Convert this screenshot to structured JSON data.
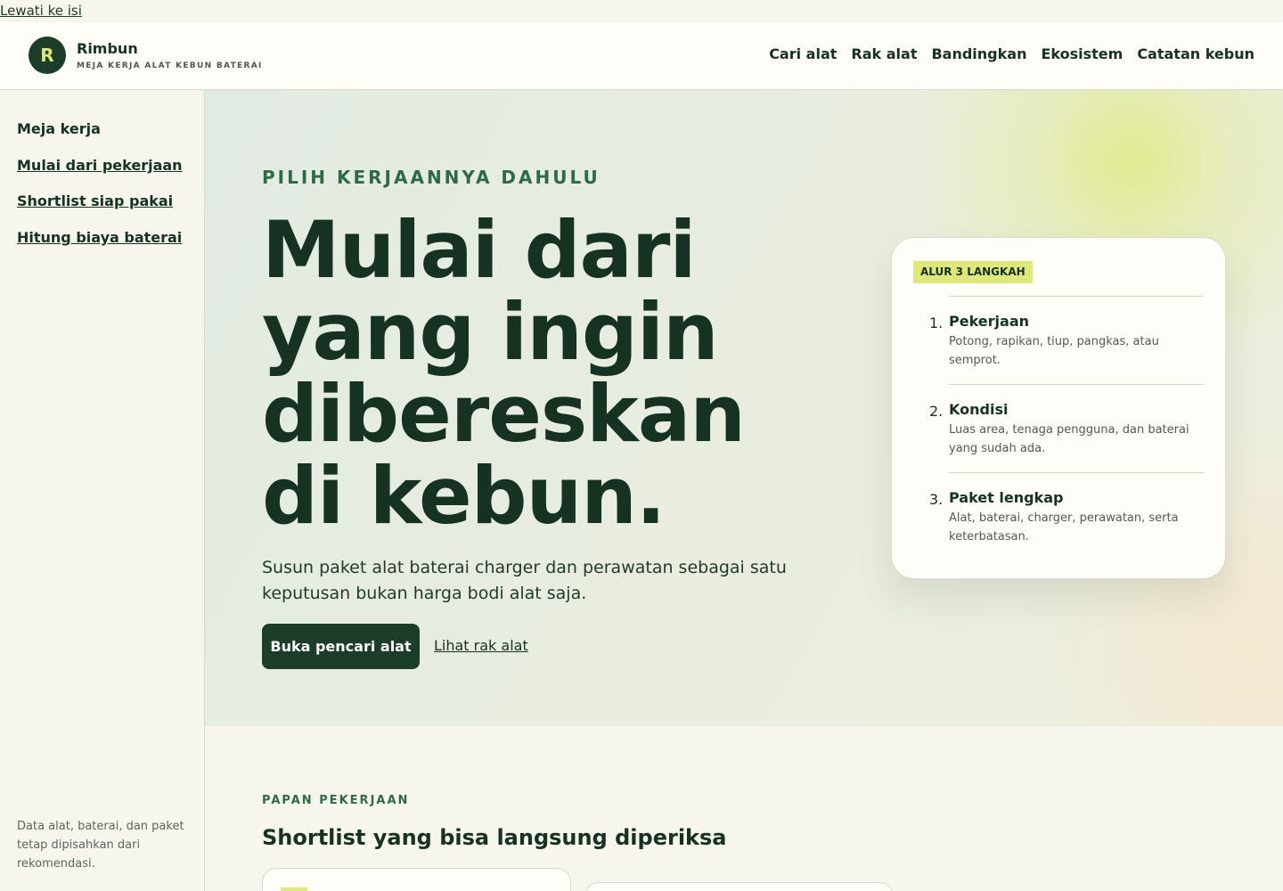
{
  "skip_link": "Lewati ke isi",
  "brand": {
    "logo_letter": "R",
    "name": "Rimbun",
    "tagline": "MEJA KERJA ALAT KEBUN BATERAI"
  },
  "nav": [
    "Cari alat",
    "Rak alat",
    "Bandingkan",
    "Ekosistem",
    "Catatan kebun"
  ],
  "sidebar": {
    "title": "Meja kerja",
    "links": [
      "Mulai dari pekerjaan",
      "Shortlist siap pakai",
      "Hitung biaya baterai"
    ],
    "note": "Data alat, baterai, dan paket tetap dipisahkan dari rekomendasi."
  },
  "hero": {
    "eyebrow": "PILIH KERJAANNYA DAHULU",
    "title": "Mulai dari yang ingin dibereskan di kebun.",
    "description": "Susun paket alat baterai charger dan perawatan sebagai satu keputusan bukan harga bodi alat saja.",
    "primary_button": "Buka pencari alat",
    "secondary_link": "Lihat rak alat"
  },
  "steps_card": {
    "badge": "ALUR 3 LANGKAH",
    "steps": [
      {
        "num": "1.",
        "title": "Pekerjaan",
        "desc": "Potong, rapikan, tiup, pangkas, atau semprot."
      },
      {
        "num": "2.",
        "title": "Kondisi",
        "desc": "Luas area, tenaga pengguna, dan baterai yang sudah ada."
      },
      {
        "num": "3.",
        "title": "Paket lengkap",
        "desc": "Alat, baterai, charger, perawatan, serta keterbatasan."
      }
    ]
  },
  "section": {
    "eyebrow": "PAPAN PEKERJAAN",
    "title": "Shortlist yang bisa langsung diperiksa"
  },
  "colors": {
    "primary": "#1b3d29",
    "accent": "#dde879",
    "eyebrow": "#2c6b47"
  }
}
